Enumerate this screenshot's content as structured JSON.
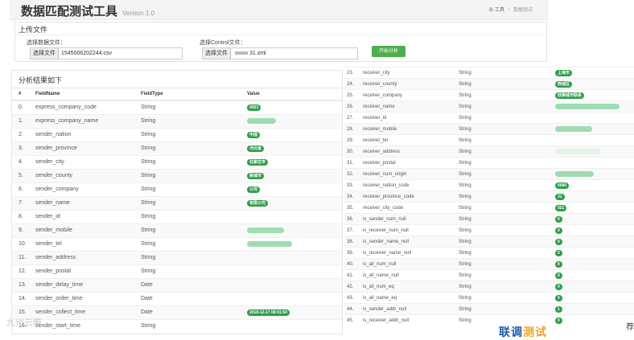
{
  "header": {
    "title": "数据匹配测试工具",
    "version": "Version 1.0",
    "crumb_home": "工具",
    "crumb_sep": "/",
    "crumb_current": "数据测试"
  },
  "upload": {
    "title": "上传文件",
    "data_label": "选择数据文件：",
    "data_button": "选择文件",
    "data_filename": "1545006202244.csv",
    "control_label": "选择Control文件：",
    "control_button": "选择文件",
    "control_filename": "31.xml",
    "run_button": "开始分析"
  },
  "results": {
    "title": "分析结果如下",
    "columns": [
      "#",
      "FieldName",
      "FieldType",
      "Value"
    ],
    "left_rows": [
      {
        "idx": "0.",
        "name": "express_company_code",
        "type": "String",
        "value": "0003",
        "kind": "badge"
      },
      {
        "idx": "1.",
        "name": "express_company_name",
        "type": "String",
        "value": "",
        "kind": "blur"
      },
      {
        "idx": "2.",
        "name": "sender_nation",
        "type": "String",
        "value": "中国",
        "kind": "badge"
      },
      {
        "idx": "3.",
        "name": "sender_province",
        "type": "String",
        "value": "河北省",
        "kind": "badge"
      },
      {
        "idx": "4.",
        "name": "sender_city",
        "type": "String",
        "value": "石家庄市",
        "kind": "badge"
      },
      {
        "idx": "5.",
        "name": "sender_county",
        "type": "String",
        "value": "新城市",
        "kind": "badge"
      },
      {
        "idx": "6.",
        "name": "sender_company",
        "type": "String",
        "value": "公司",
        "kind": "badge"
      },
      {
        "idx": "7.",
        "name": "sender_name",
        "type": "String",
        "value": "有限公司",
        "kind": "badge"
      },
      {
        "idx": "8.",
        "name": "sender_id",
        "type": "String",
        "value": "",
        "kind": "none"
      },
      {
        "idx": "9.",
        "name": "sender_mobile",
        "type": "String",
        "value": "",
        "kind": "blur"
      },
      {
        "idx": "10.",
        "name": "sender_tel",
        "type": "String",
        "value": "",
        "kind": "blur"
      },
      {
        "idx": "11.",
        "name": "sender_address",
        "type": "String",
        "value": "",
        "kind": "none"
      },
      {
        "idx": "12.",
        "name": "sender_postal",
        "type": "String",
        "value": "",
        "kind": "none"
      },
      {
        "idx": "13.",
        "name": "sender_delay_time",
        "type": "Date",
        "value": "",
        "kind": "none"
      },
      {
        "idx": "14.",
        "name": "sender_order_time",
        "type": "Date",
        "value": "",
        "kind": "none"
      },
      {
        "idx": "15.",
        "name": "sender_collect_time",
        "type": "Date",
        "value": "2018-12-17 08:01:50",
        "kind": "badge"
      },
      {
        "idx": "16.",
        "name": "sender_start_time",
        "type": "String",
        "value": "",
        "kind": "none"
      }
    ],
    "right_rows": [
      {
        "idx": "23.",
        "name": "receiver_city",
        "type": "String",
        "value": "上海市",
        "kind": "badge"
      },
      {
        "idx": "24.",
        "name": "receiver_county",
        "type": "String",
        "value": "西城区",
        "kind": "badge"
      },
      {
        "idx": "25.",
        "name": "receiver_company",
        "type": "String",
        "value": "欣荣城市联系",
        "kind": "badge"
      },
      {
        "idx": "26.",
        "name": "receiver_name",
        "type": "String",
        "value": "",
        "kind": "blur"
      },
      {
        "idx": "27.",
        "name": "receiver_id",
        "type": "String",
        "value": "",
        "kind": "none"
      },
      {
        "idx": "28.",
        "name": "receiver_mobile",
        "type": "String",
        "value": "",
        "kind": "blur"
      },
      {
        "idx": "29.",
        "name": "receiver_tel",
        "type": "String",
        "value": "",
        "kind": "none"
      },
      {
        "idx": "30.",
        "name": "receiver_address",
        "type": "String",
        "value": "",
        "kind": "faint"
      },
      {
        "idx": "31.",
        "name": "receiver_postal",
        "type": "String",
        "value": "",
        "kind": "none"
      },
      {
        "idx": "32.",
        "name": "receiver_num_origin",
        "type": "String",
        "value": "",
        "kind": "blur"
      },
      {
        "idx": "33.",
        "name": "receiver_nation_code",
        "type": "String",
        "value": "0086",
        "kind": "badge"
      },
      {
        "idx": "34.",
        "name": "receiver_province_code",
        "type": "String",
        "value": "31",
        "kind": "badge"
      },
      {
        "idx": "35.",
        "name": "receiver_city_code",
        "type": "String",
        "value": "021",
        "kind": "badge"
      },
      {
        "idx": "36.",
        "name": "is_sender_num_null",
        "type": "String",
        "value": "0",
        "kind": "badge"
      },
      {
        "idx": "37.",
        "name": "is_receiver_num_null",
        "type": "String",
        "value": "0",
        "kind": "badge"
      },
      {
        "idx": "38.",
        "name": "is_sender_name_null",
        "type": "String",
        "value": "0",
        "kind": "badge"
      },
      {
        "idx": "39.",
        "name": "is_receiver_name_null",
        "type": "String",
        "value": "0",
        "kind": "badge"
      },
      {
        "idx": "40.",
        "name": "is_all_num_null",
        "type": "String",
        "value": "0",
        "kind": "badge"
      },
      {
        "idx": "41.",
        "name": "is_all_name_null",
        "type": "String",
        "value": "0",
        "kind": "badge"
      },
      {
        "idx": "42.",
        "name": "is_all_num_eq",
        "type": "String",
        "value": "0",
        "kind": "badge"
      },
      {
        "idx": "43.",
        "name": "is_all_name_eq",
        "type": "String",
        "value": "0",
        "kind": "badge"
      },
      {
        "idx": "44.",
        "name": "is_sender_addr_null",
        "type": "String",
        "value": "1",
        "kind": "badge"
      },
      {
        "idx": "45.",
        "name": "is_receiver_addr_null",
        "type": "String",
        "value": "0",
        "kind": "badge"
      }
    ]
  },
  "watermark": "九州云腾",
  "logo": {
    "left": "联调",
    "accent": "测试"
  },
  "corner": "荐",
  "colors": {
    "badge": "#2e9e4a",
    "run_button": "#4cae4c",
    "header_bg": "#f4f4f4"
  }
}
